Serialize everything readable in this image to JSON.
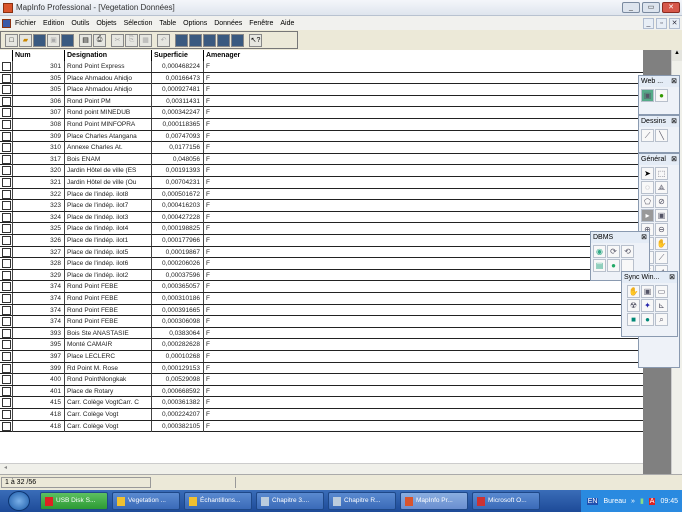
{
  "window": {
    "title": "MapInfo Professional - [Vegetation Données]"
  },
  "menu": [
    "Fichier",
    "Edition",
    "Outils",
    "Objets",
    "Sélection",
    "Table",
    "Options",
    "Données",
    "Fenêtre",
    "Aide"
  ],
  "table": {
    "columns": [
      "",
      "Num",
      "Designation",
      "Superficie",
      "Amenager"
    ],
    "rows": [
      [
        "301",
        "Rond Point Express",
        "0,000468224",
        "F"
      ],
      [
        "305",
        "Place Ahmadou Ahidjo",
        "0,00166473",
        "F"
      ],
      [
        "305",
        "Place Ahmadou Ahidjo",
        "0,000927481",
        "F"
      ],
      [
        "306",
        "Rond Point PM",
        "0,00311431",
        "F"
      ],
      [
        "307",
        "Rond point MINEDUB",
        "0,000342247",
        "F"
      ],
      [
        "308",
        "Rond Point MINFOPRA",
        "0,000118365",
        "F"
      ],
      [
        "309",
        "Place Charles Atangana",
        "0,00747093",
        "F"
      ],
      [
        "310",
        "Annexe Charles At.",
        "0,0177156",
        "F"
      ],
      [
        "317",
        "Bois ENAM",
        "0,048056",
        "F"
      ],
      [
        "320",
        "Jardin Hôtel de ville (ES",
        "0,00191393",
        "F"
      ],
      [
        "321",
        "Jardin Hôtel de ville (Ou",
        "0,00704231",
        "F"
      ],
      [
        "322",
        "Place de l'indép. ilot8",
        "0,000501672",
        "F"
      ],
      [
        "323",
        "Place de l'indép. ilot7",
        "0,000416203",
        "F"
      ],
      [
        "324",
        "Place de l'indép. ilot3",
        "0,000427228",
        "F"
      ],
      [
        "325",
        "Place de l'indép. ilot4",
        "0,000198825",
        "F"
      ],
      [
        "326",
        "Place de l'indép. ilot1",
        "0,000177966",
        "F"
      ],
      [
        "327",
        "Place de l'indép. ilot5",
        "0,00019867",
        "F"
      ],
      [
        "328",
        "Place de l'indép. ilot6",
        "0,000206026",
        "F"
      ],
      [
        "329",
        "Place de l'indép. ilot2",
        "0,00037596",
        "F"
      ],
      [
        "374",
        "Rond Point FEBE",
        "0,000365057",
        "F"
      ],
      [
        "374",
        "Rond Point FEBE",
        "0,000310186",
        "F"
      ],
      [
        "374",
        "Rond Point FEBE",
        "0,000391665",
        "F"
      ],
      [
        "374",
        "Rond Point FEBE",
        "0,000306098",
        "F"
      ],
      [
        "393",
        "Bois Ste ANASTASIE",
        "0,0383064",
        "F"
      ],
      [
        "395",
        "Monté CAMAIR",
        "0,000282628",
        "F"
      ],
      [
        "397",
        "Place LECLERC",
        "0,00010268",
        "F"
      ],
      [
        "399",
        "Rd Point M. Rose",
        "0,000129153",
        "F"
      ],
      [
        "400",
        "Rond PointNlongkak",
        "0,00529098",
        "F"
      ],
      [
        "401",
        "Place de Rotary",
        "0,000668592",
        "F"
      ],
      [
        "415",
        "Carr. Colège VogtCarr. C",
        "0,000361382",
        "F"
      ],
      [
        "418",
        "Carr. Colège Vogt",
        "0,000224207",
        "F"
      ],
      [
        "418",
        "Carr. Colège Vogt",
        "0,000382105",
        "F"
      ]
    ]
  },
  "status": {
    "records": "1 à 32 /56"
  },
  "palettes": {
    "web": "Web ...",
    "dessins": "Dessins",
    "general": "Général",
    "dbms": "DBMS",
    "sync": "Sync Win..."
  },
  "taskbar": {
    "items": [
      "USB Disk S...",
      "Vegetation ...",
      "Échantillons...",
      "Chapitre 3....",
      "Chapitre R...",
      "MapInfo Pr...",
      "Microsoft O..."
    ],
    "toolbar_label": "Bureau",
    "lang": "EN",
    "clock": "09:45"
  }
}
